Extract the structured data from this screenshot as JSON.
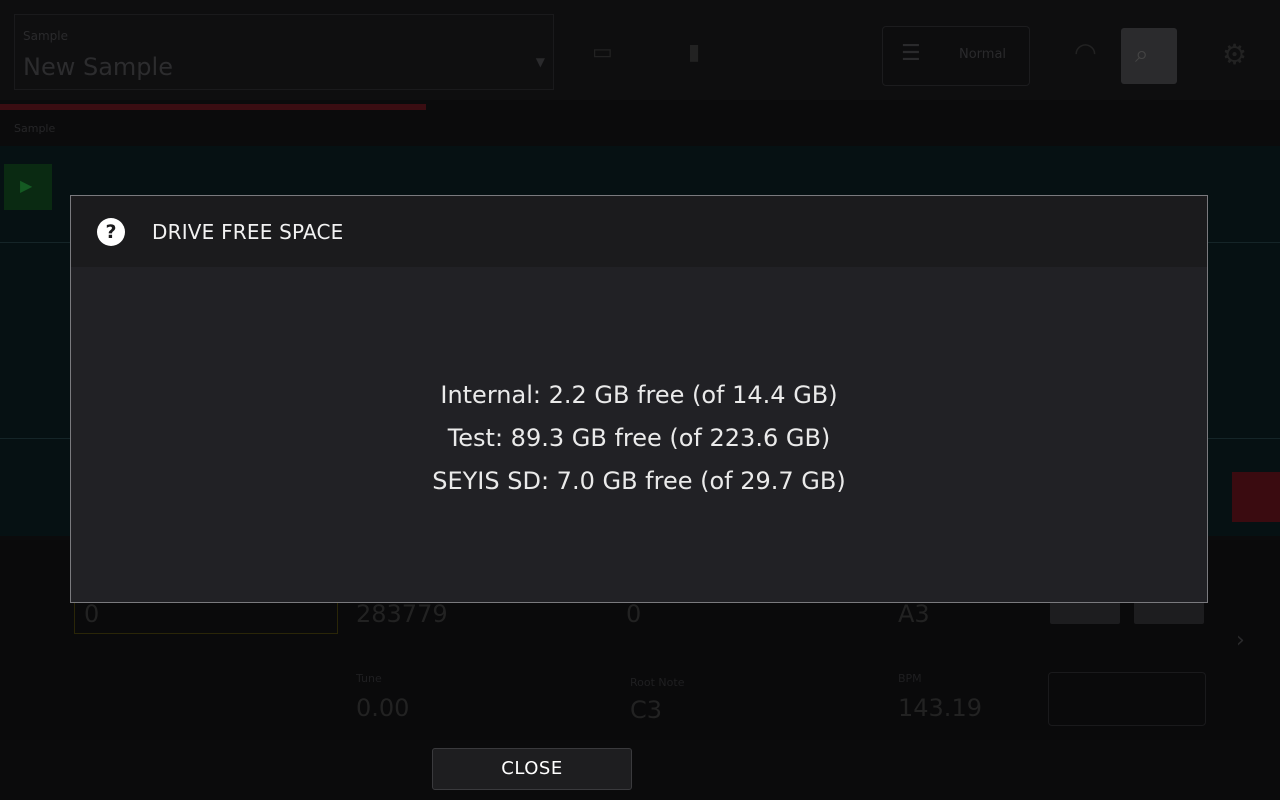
{
  "background": {
    "sample": {
      "label": "Sample",
      "name": "New Sample"
    },
    "mode_button": {
      "label": "Normal"
    },
    "nav": {
      "first_item": "Sample"
    },
    "fields": {
      "start": "0",
      "end": "283779",
      "loop": "0",
      "root": "A3",
      "tune": "0.00",
      "root_note_label": "Root Note",
      "root_note": "C3",
      "tune_label": "Tune",
      "bpm_label": "BPM",
      "bpm": "143.19"
    }
  },
  "dialog": {
    "title": "DRIVE FREE SPACE",
    "icon": "question-icon",
    "drives": [
      {
        "text": "Internal: 2.2 GB free (of 14.4 GB)"
      },
      {
        "text": "Test: 89.3 GB free (of 223.6 GB)"
      },
      {
        "text": "SEYIS SD: 7.0 GB free (of 29.7 GB)"
      }
    ]
  },
  "footer": {
    "close_label": "CLOSE"
  },
  "colors": {
    "modal_bg": "#212125",
    "modal_header_bg": "#1b1b1d",
    "modal_border": "#7a7a7e",
    "text": "#eaeaea"
  }
}
